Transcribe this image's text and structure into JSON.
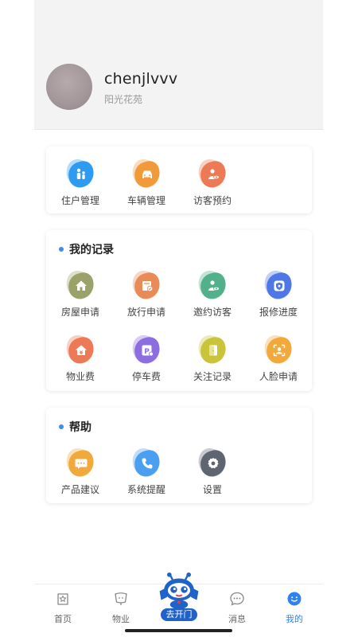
{
  "profile": {
    "username": "chenjlvvv",
    "community": "阳光花苑"
  },
  "top_card": {
    "items": [
      {
        "label": "住户管理",
        "icon": "resident-icon",
        "color": "#2f9bf0"
      },
      {
        "label": "车辆管理",
        "icon": "car-icon",
        "color": "#f19a3b"
      },
      {
        "label": "访客预约",
        "icon": "visitor-eye-icon",
        "color": "#ec7a57"
      }
    ]
  },
  "records_card": {
    "title": "我的记录",
    "items": [
      {
        "label": "房屋申请",
        "icon": "house-icon",
        "color": "#9aa26a"
      },
      {
        "label": "放行申请",
        "icon": "release-icon",
        "color": "#e98b57"
      },
      {
        "label": "邀约访客",
        "icon": "invite-visitor-icon",
        "color": "#52b08a"
      },
      {
        "label": "报修进度",
        "icon": "repair-shield-icon",
        "color": "#4f78e6"
      },
      {
        "label": "物业费",
        "icon": "property-fee-icon",
        "color": "#ec7a57"
      },
      {
        "label": "停车费",
        "icon": "parking-fee-icon",
        "color": "#8d6ee0"
      },
      {
        "label": "关注记录",
        "icon": "door-icon",
        "color": "#c9c43a"
      },
      {
        "label": "人脸申请",
        "icon": "face-icon",
        "color": "#f2a93b"
      }
    ]
  },
  "help_card": {
    "title": "帮助",
    "items": [
      {
        "label": "产品建议",
        "icon": "chat-bubble-icon",
        "color": "#f2a93b"
      },
      {
        "label": "系统提醒",
        "icon": "phone-icon",
        "color": "#4a9ff0"
      },
      {
        "label": "设置",
        "icon": "gear-icon",
        "color": "#5f6672"
      }
    ]
  },
  "tabbar": {
    "tabs": [
      {
        "label": "首页",
        "icon": "home-star-icon"
      },
      {
        "label": "物业",
        "icon": "property-icon"
      },
      {
        "label": "去开门",
        "icon": "robot-mascot-icon"
      },
      {
        "label": "消息",
        "icon": "message-icon"
      },
      {
        "label": "我的",
        "icon": "profile-smile-icon",
        "active": true
      }
    ],
    "active_color": "#2f83ee"
  }
}
